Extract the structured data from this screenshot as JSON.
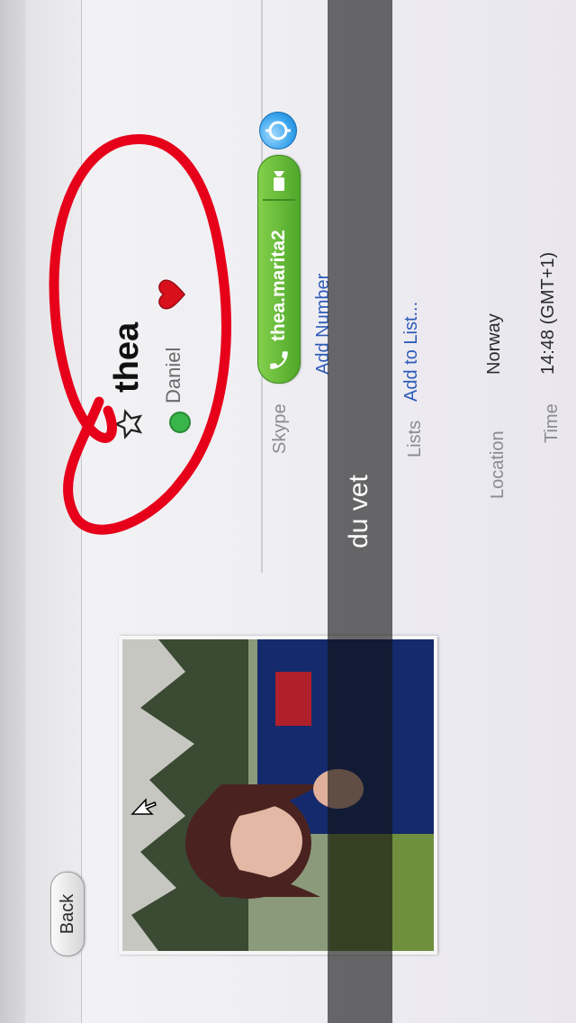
{
  "header": {
    "back_label": "Back"
  },
  "profile": {
    "display_name": "thea",
    "mood": "Daniel",
    "status_color": "#39b54a"
  },
  "contact": {
    "skype_label": "Skype",
    "skype_name": "thea.marita2",
    "add_number_label": "Add Number",
    "lists_label": "Lists",
    "add_to_list_label": "Add to List...",
    "location_label": "Location",
    "location_value": "Norway",
    "time_label": "Time",
    "time_value": "14:48 (GMT+1)"
  },
  "overlay": {
    "caption": "du vet",
    "annotation_color": "#e6001a"
  },
  "colors": {
    "skype_green": "#5cb832",
    "link_blue": "#2e5bb8",
    "info_blue": "#36a3ec"
  },
  "icons": {
    "favorite": "star-outline-icon",
    "status": "online-status-icon",
    "mood_emoji": "heart-icon",
    "call": "phone-icon",
    "video": "video-camera-icon",
    "info": "info-icon",
    "pointer": "mouse-cursor-icon"
  }
}
